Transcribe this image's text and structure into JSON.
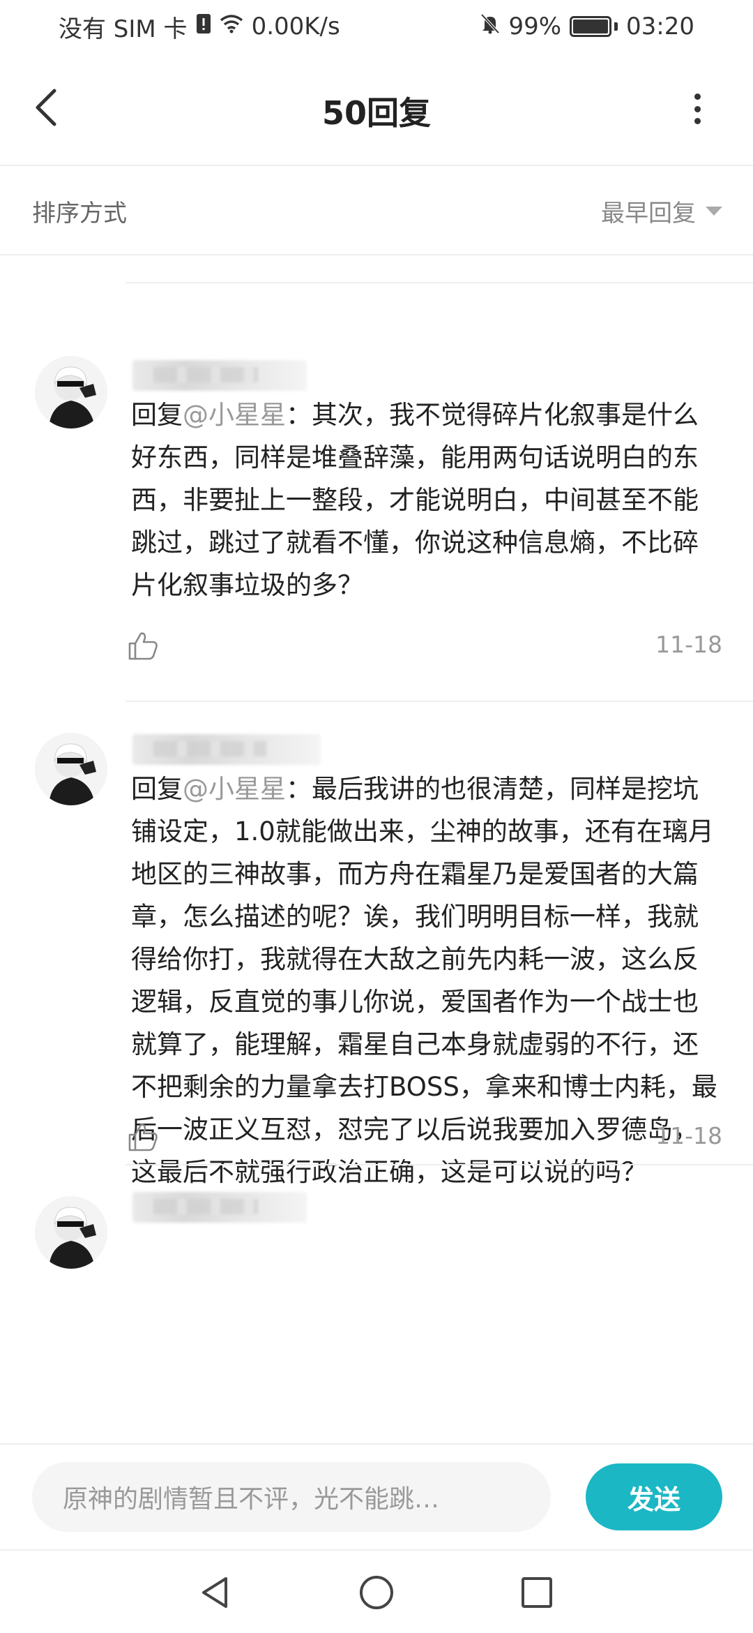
{
  "status_bar": {
    "carrier": "没有 SIM 卡",
    "speed": "0.00K/s",
    "battery": "99%",
    "battery_level": 0.99,
    "time": "03:20",
    "icons": [
      "sim-alert-icon",
      "wifi-icon",
      "mute-icon",
      "battery-icon"
    ]
  },
  "header": {
    "title": "50回复"
  },
  "sort": {
    "label": "排序方式",
    "selected": "最早回复"
  },
  "comments": [
    {
      "reply_prefix": "回复",
      "mention": "@小星星",
      "text": "：其次，我不觉得碎片化叙事是什么好东西，同样是堆叠辞藻，能用两句话说明白的东西，非要扯上一整段，才能说明白，中间甚至不能跳过，跳过了就看不懂，你说这种信息熵，不比碎片化叙事垃圾的多？",
      "date": "11-18"
    },
    {
      "reply_prefix": "回复",
      "mention": "@小星星",
      "text": "：最后我讲的也很清楚，同样是挖坑铺设定，1.0就能做出来，尘神的故事，还有在璃月地区的三神故事，而方舟在霜星乃是爱国者的大篇章，怎么描述的呢？诶，我们明明目标一样，我就得给你打，我就得在大敌之前先内耗一波，这么反逻辑，反直觉的事儿你说，爱国者作为一个战士也就算了，能理解，霜星自己本身就虚弱的不行，还不把剩余的力量拿去打BOSS，拿来和博士内耗，最后一波正义互怼，怼完了以后说我要加入罗德岛，这最后不就强行政治正确，这是可以说的吗？",
      "date": "11-18"
    }
  ],
  "reply_bar": {
    "placeholder": "原神的剧情暂且不评，光不能跳…",
    "send_label": "发送",
    "accent": "#1bb7c5"
  }
}
